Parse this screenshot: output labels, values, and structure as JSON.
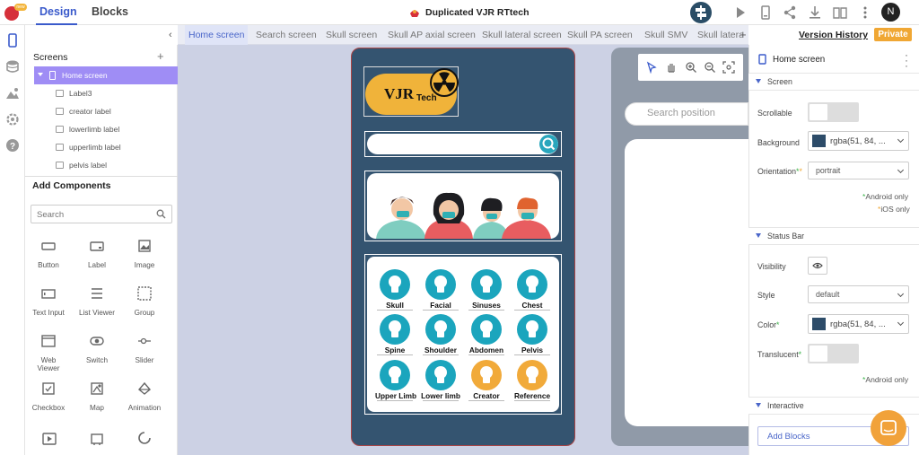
{
  "topbar": {
    "tabs": [
      {
        "label": "Design",
        "active": true
      },
      {
        "label": "Blocks",
        "active": false
      }
    ],
    "project_title": "Duplicated VJR RTtech",
    "avatar_initial": "N",
    "accent_color": "#3a5acb"
  },
  "screen_tabs": [
    "Home screen",
    "Search screen",
    "Skull screen",
    "Skull AP axial screen",
    "Skull lateral screen",
    "Skull PA screen",
    "Skull SMV",
    "Skull latera"
  ],
  "active_screen_tab": "Home screen",
  "version_history": "Version History",
  "privacy": "Private",
  "left_panel": {
    "screens_title": "Screens",
    "tree": [
      {
        "label": "Home screen",
        "selected": true
      },
      {
        "label": "Label3",
        "selected": false
      },
      {
        "label": "creator label",
        "selected": false
      },
      {
        "label": "lowerlimb label",
        "selected": false
      },
      {
        "label": "upperlimb label",
        "selected": false
      },
      {
        "label": "pelvis label",
        "selected": false
      }
    ],
    "add_components_title": "Add Components",
    "search_placeholder": "Search",
    "components": [
      {
        "label": "Button",
        "icon": "button-icon"
      },
      {
        "label": "Label",
        "icon": "label-icon"
      },
      {
        "label": "Image",
        "icon": "image-icon"
      },
      {
        "label": "Text Input",
        "icon": "text-input-icon"
      },
      {
        "label": "List Viewer",
        "icon": "list-icon"
      },
      {
        "label": "Group",
        "icon": "group-icon"
      },
      {
        "label": "Web\nViewer",
        "icon": "web-viewer-icon"
      },
      {
        "label": "Switch",
        "icon": "switch-icon"
      },
      {
        "label": "Slider",
        "icon": "slider-icon"
      },
      {
        "label": "Checkbox",
        "icon": "checkbox-icon"
      },
      {
        "label": "Map",
        "icon": "map-icon"
      },
      {
        "label": "Animation",
        "icon": "animation-icon"
      }
    ]
  },
  "canvas": {
    "brand_main": "VJR",
    "brand_sub": "Tech",
    "categories": [
      {
        "label": "Skull",
        "color": "#1ba5bd"
      },
      {
        "label": "Facial",
        "color": "#1ba5bd"
      },
      {
        "label": "Sinuses",
        "color": "#1ba5bd"
      },
      {
        "label": "Chest",
        "color": "#1ba5bd"
      },
      {
        "label": "Spine",
        "color": "#1ba5bd"
      },
      {
        "label": "Shoulder",
        "color": "#1ba5bd"
      },
      {
        "label": "Abdomen",
        "color": "#1ba5bd"
      },
      {
        "label": "Pelvis",
        "color": "#1ba5bd"
      },
      {
        "label": "Upper Limb",
        "color": "#1ba5bd"
      },
      {
        "label": "Lower limb",
        "color": "#1ba5bd"
      },
      {
        "label": "Creator",
        "color": "#f1aa3a"
      },
      {
        "label": "Reference",
        "color": "#f1aa3a"
      }
    ],
    "search_position_placeholder": "Search position",
    "phone_bg": "#345470"
  },
  "right_panel": {
    "component_title": "Home screen",
    "sections": {
      "screen": "Screen",
      "status_bar": "Status Bar",
      "interactive": "Interactive"
    },
    "scrollable_label": "Scrollable",
    "background_label": "Background",
    "background_value": "rgba(51, 84, ...",
    "orientation_label": "Orientation",
    "orientation_value": "portrait",
    "android_only": "Android only",
    "ios_only": "iOS only",
    "visibility_label": "Visibility",
    "style_label": "Style",
    "style_value": "default",
    "color_label": "Color",
    "color_value": "rgba(51, 84, ...",
    "translucent_label": "Translucent",
    "add_blocks": "Add Blocks"
  }
}
